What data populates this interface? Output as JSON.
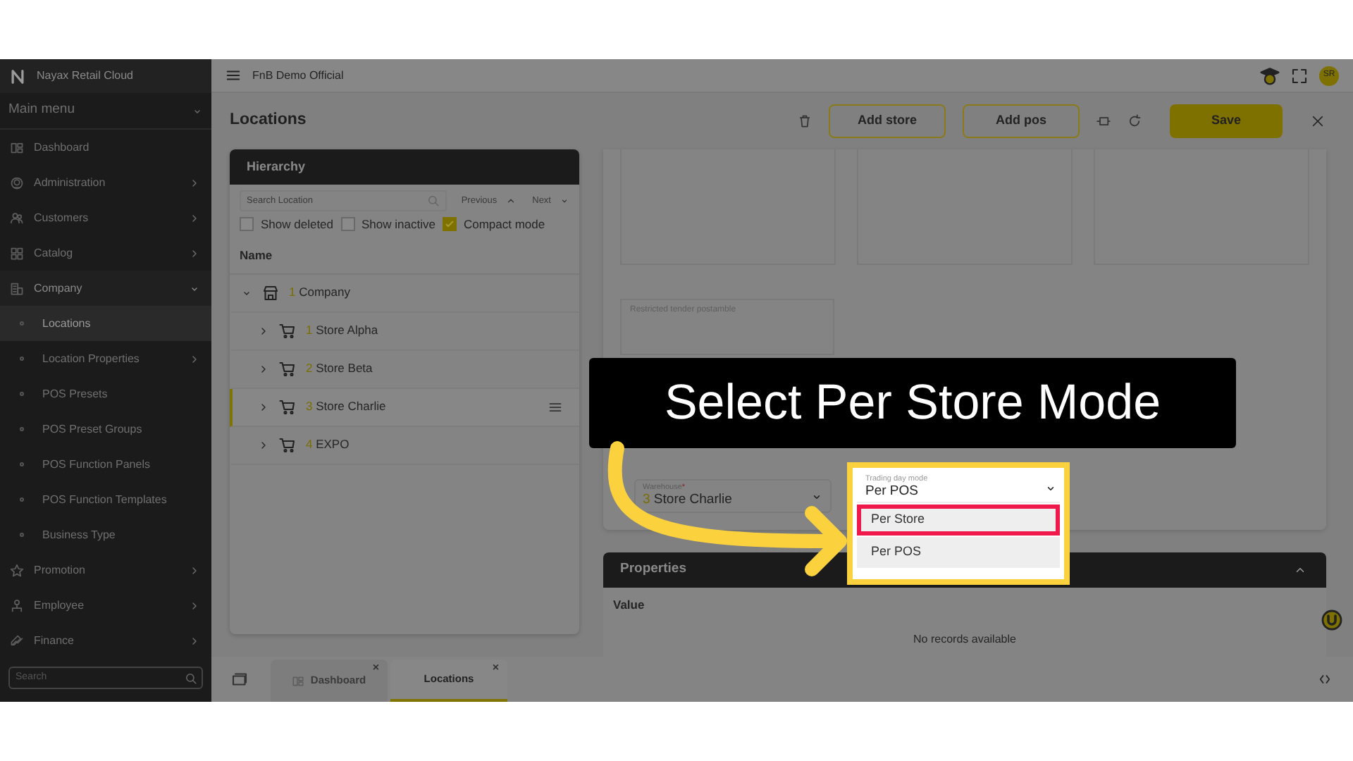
{
  "app": {
    "title": "Nayax Retail Cloud"
  },
  "sidebar": {
    "menu_label": "Main menu",
    "search_placeholder": "Search",
    "items": [
      {
        "label": "Dashboard",
        "kind": "link",
        "selected": false
      },
      {
        "label": "Administration",
        "kind": "group",
        "expanded": false,
        "selected": false
      },
      {
        "label": "Customers",
        "kind": "group",
        "expanded": false,
        "selected": false
      },
      {
        "label": "Catalog",
        "kind": "group",
        "expanded": false,
        "selected": false
      },
      {
        "label": "Company",
        "kind": "group",
        "expanded": true,
        "selected": false,
        "children": [
          {
            "label": "Locations",
            "kind": "link",
            "selected": true
          },
          {
            "label": "Location Properties",
            "kind": "group",
            "expanded": false,
            "selected": false
          },
          {
            "label": "POS Presets",
            "kind": "link",
            "selected": false
          },
          {
            "label": "POS Preset Groups",
            "kind": "link",
            "selected": false
          },
          {
            "label": "POS Function Panels",
            "kind": "link",
            "selected": false
          },
          {
            "label": "POS Function Templates",
            "kind": "link",
            "selected": false
          },
          {
            "label": "Business Type",
            "kind": "link",
            "selected": false
          }
        ]
      },
      {
        "label": "Promotion",
        "kind": "group",
        "expanded": false,
        "selected": false
      },
      {
        "label": "Employee",
        "kind": "group",
        "expanded": false,
        "selected": false
      },
      {
        "label": "Finance",
        "kind": "group",
        "expanded": false,
        "selected": false
      }
    ]
  },
  "topbar": {
    "organization": "FnB Demo Official",
    "avatar": "SR"
  },
  "page": {
    "title": "Locations",
    "buttons": [
      {
        "label": "Add store",
        "kind": "outline"
      },
      {
        "label": "Add pos",
        "kind": "outline"
      },
      {
        "label": "Save",
        "kind": "primary"
      }
    ]
  },
  "hierarchy": {
    "title": "Hierarchy",
    "search_placeholder": "Search Location",
    "previous": "Previous",
    "next": "Next",
    "filters": [
      {
        "label": "Show deleted",
        "checked": false
      },
      {
        "label": "Show inactive",
        "checked": false
      },
      {
        "label": "Compact mode",
        "checked": true
      }
    ],
    "column": "Name",
    "nodes": [
      {
        "number": "1",
        "name": "Company",
        "expanded": true,
        "selected": false,
        "children": [
          {
            "number": "1",
            "name": "Store Alpha",
            "expanded": false,
            "selected": false
          },
          {
            "number": "2",
            "name": "Store Beta",
            "expanded": false,
            "selected": false
          },
          {
            "number": "3",
            "name": "Store Charlie",
            "expanded": false,
            "selected": true
          },
          {
            "number": "4",
            "name": "EXPO",
            "expanded": false,
            "selected": false
          }
        ]
      }
    ]
  },
  "details": {
    "postamble_label": "Restricted tender postamble",
    "warehouse": {
      "label": "Warehouse",
      "required_mark": "*",
      "number": "3",
      "value": "Store Charlie"
    },
    "trading_day": {
      "label": "Trading day mode",
      "value": "Per POS",
      "options": [
        {
          "label": "Per Store",
          "annotated": true
        },
        {
          "label": "Per POS",
          "annotated": false
        }
      ]
    }
  },
  "callout": {
    "text": "Select Per Store Mode"
  },
  "properties": {
    "title": "Properties",
    "column": "Value",
    "empty": "No records available"
  },
  "tabs": [
    {
      "label": "Dashboard",
      "selected": false,
      "close": "×"
    },
    {
      "label": "Locations",
      "selected": true,
      "close": "×"
    }
  ]
}
